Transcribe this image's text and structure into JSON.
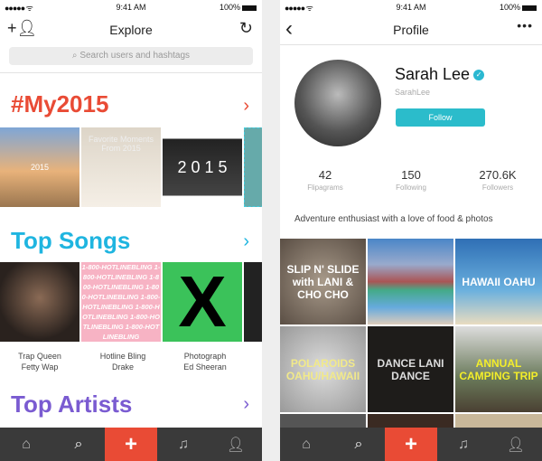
{
  "status": {
    "signal": "●●●●● ᯤ",
    "time": "9:41 AM",
    "battery": "100%"
  },
  "explore": {
    "title": "Explore",
    "search_placeholder": "Search users and hashtags",
    "sections": {
      "my2015": {
        "title": "#My2015",
        "color": "#e94b35",
        "tiles": [
          "2015",
          "Favorite Moments From 2015",
          "2 0 1 5",
          ""
        ]
      },
      "songs": {
        "title": "Top Songs",
        "color": "#1fb5e0",
        "tiles": [
          "",
          "1-800-HOTLINEBLING",
          "X",
          ""
        ],
        "items": [
          {
            "song": "Trap Queen",
            "artist": "Fetty Wap"
          },
          {
            "song": "Hotline Bling",
            "artist": "Drake"
          },
          {
            "song": "Photograph",
            "artist": "Ed Sheeran"
          }
        ]
      },
      "artists": {
        "title": "Top Artists",
        "color": "#7a5bd1"
      }
    }
  },
  "profile": {
    "title": "Profile",
    "name": "Sarah Lee",
    "handle": "SarahLee",
    "follow_label": "Follow",
    "stats": [
      {
        "value": "42",
        "label": "Flipagrams"
      },
      {
        "value": "150",
        "label": "Following"
      },
      {
        "value": "270.6K",
        "label": "Followers"
      }
    ],
    "bio": "Adventure enthusiast with a love of food & photos",
    "grid": [
      "SLIP N' SLIDE with LANI & CHO CHO",
      "",
      "HAWAII OAHU",
      "POLAROIDS OAHU/HAWAII",
      "DANCE LANI DANCE",
      "ANNUAL CAMPING TRIP",
      "",
      "",
      ""
    ]
  },
  "tabs": [
    "home-icon",
    "search-icon",
    "plus-icon",
    "music-icon",
    "profile-icon"
  ],
  "accent": "#e94b35"
}
